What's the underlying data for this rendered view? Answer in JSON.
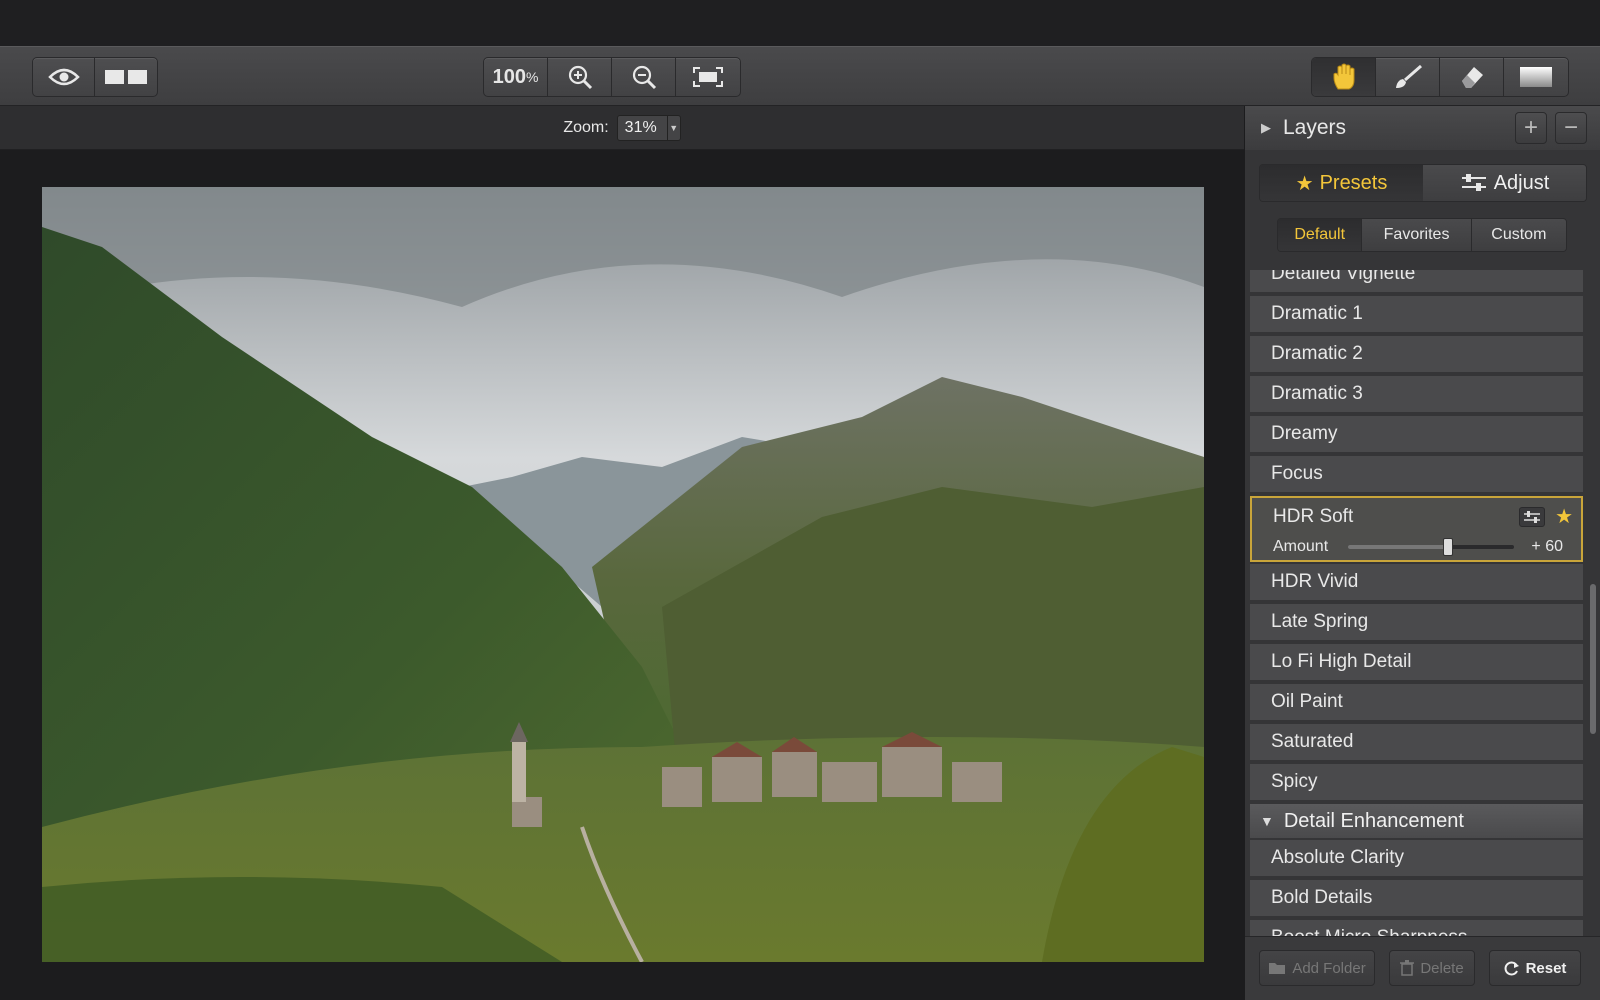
{
  "toolbar": {
    "zoom_percent": "100",
    "zoom_percent_unit": "%",
    "icons": [
      "eye-icon",
      "compare-icon",
      "zoom-in-icon",
      "zoom-out-icon",
      "fit-screen-icon",
      "hand-icon",
      "brush-icon",
      "eraser-icon",
      "gradient-icon"
    ]
  },
  "zoombar": {
    "label": "Zoom:",
    "value": "31%"
  },
  "panel": {
    "layers_title": "Layers",
    "tabs": [
      {
        "label": "Presets",
        "active": true
      },
      {
        "label": "Adjust",
        "active": false
      }
    ],
    "subtabs": [
      {
        "label": "Default",
        "active": true
      },
      {
        "label": "Favorites",
        "active": false
      },
      {
        "label": "Custom",
        "active": false
      }
    ],
    "presets": [
      "Detailed Vignette",
      "Dramatic 1",
      "Dramatic 2",
      "Dramatic 3",
      "Dreamy",
      "Focus"
    ],
    "selected_preset": {
      "name": "HDR Soft",
      "amount_label": "Amount",
      "amount_value": "+ 60",
      "amount_fraction": 0.6,
      "favorite": true
    },
    "presets_after": [
      "HDR Vivid",
      "Late Spring",
      "Lo Fi High Detail",
      "Oil Paint",
      "Saturated",
      "Spicy"
    ],
    "group_title": "Detail Enhancement",
    "group_items": [
      "Absolute Clarity",
      "Bold Details",
      "Boost Micro Sharpness"
    ],
    "buttons": {
      "add_folder": "Add Folder",
      "delete": "Delete",
      "reset": "Reset"
    }
  },
  "colors": {
    "accent": "#f3c63a",
    "panel_bg": "#353537",
    "item_bg": "#4a4a4c"
  }
}
